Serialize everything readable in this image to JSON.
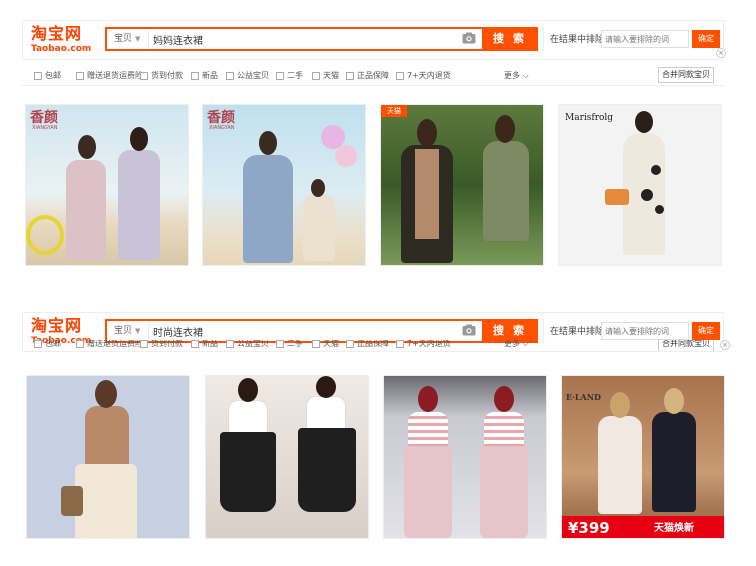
{
  "panels": [
    {
      "logo": {
        "cn": "淘宝网",
        "en": "Taobao.com"
      },
      "search": {
        "category": "宝贝",
        "query": "妈妈连衣裙",
        "button": "搜 索"
      },
      "exclude": {
        "label": "在结果中排除",
        "placeholder": "请输入要排除的词",
        "confirm": "确定"
      },
      "filters": [
        "包邮",
        "赠送退货运费险",
        "货到付款",
        "新品",
        "公益宝贝",
        "二手",
        "天猫",
        "正品保障",
        "7+天内退货"
      ],
      "more": "更多",
      "merge": "合并同款宝贝",
      "products": [
        {
          "brand": "香颜",
          "brand_sub": "XIANGYAN",
          "bg": "#cfe6ef",
          "colors": [
            "#d9c2c6",
            "#c7c2d6"
          ]
        },
        {
          "brand": "香颜",
          "brand_sub": "XIANGYAN",
          "bg": "#cfe3ec",
          "colors": [
            "#8aa6c4",
            "#e6dccd"
          ]
        },
        {
          "brand": "天猫",
          "brand_sub": "",
          "bg": "#3d5a2c",
          "colors": [
            "#b08a6a",
            "#7a8a62"
          ]
        },
        {
          "brand": "Marisfrolg",
          "brand_sub": "",
          "bg": "#f2f2f2",
          "colors": [
            "#efe8dc"
          ]
        }
      ]
    },
    {
      "logo": {
        "cn": "淘宝网",
        "en": "Taobao.com"
      },
      "search": {
        "category": "宝贝",
        "query": "时尚连衣裙",
        "button": "搜 索"
      },
      "exclude": {
        "label": "在结果中排除",
        "placeholder": "请输入要排除的词",
        "confirm": "确定"
      },
      "filters": [
        "包邮",
        "赠送退货运费险",
        "货到付款",
        "新品",
        "公益宝贝",
        "二手",
        "天猫",
        "正品保障",
        "7+天内退货"
      ],
      "more": "更多",
      "merge": "合并同款宝贝",
      "products": [
        {
          "brand": "",
          "brand_sub": "",
          "bg": "#c6cfe0",
          "colors": [
            "#b88866"
          ]
        },
        {
          "brand": "",
          "brand_sub": "",
          "bg": "#8a5a3e",
          "colors": [
            "#2a2a2a",
            "#2a2a2a"
          ]
        },
        {
          "brand": "",
          "brand_sub": "",
          "bg": "#d9d9e0",
          "colors": [
            "#e7c4c8",
            "#e7c4c8"
          ]
        },
        {
          "brand": "E·LAND",
          "brand_sub": "",
          "bg": "#b07a58",
          "colors": [
            "#f0e6e0",
            "#1e1e28"
          ],
          "price": "¥399",
          "promo": "天猫焕新"
        }
      ]
    }
  ],
  "colors": {
    "accent": "#ff5000",
    "logo": "#ff4400",
    "border": "#eeeeee"
  },
  "icons": {
    "camera": "camera-icon",
    "close": "close-icon",
    "chevron": "chevron-down-icon"
  }
}
